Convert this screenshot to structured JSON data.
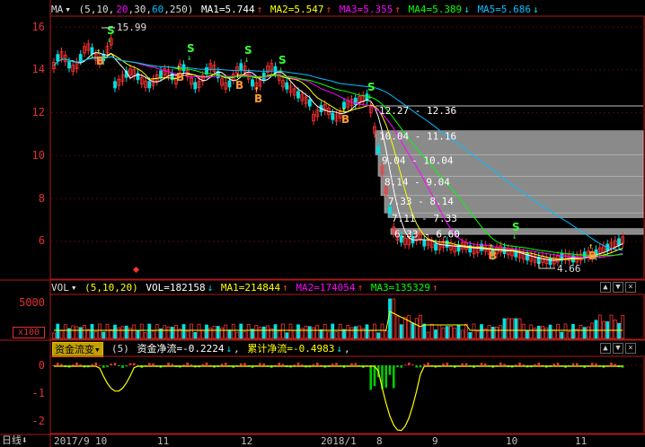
{
  "main_header": {
    "indicator": "MA",
    "params_open": "(5,10,",
    "p20": "20",
    "p30": ",30,",
    "p60": "60",
    "p250": ",250)",
    "ma1": "MA1=5.744",
    "ma2": "MA2=5.547",
    "ma3": "MA3=5.355",
    "ma4": "MA4=5.389",
    "ma5": "MA5=5.686",
    "arrow_up": "↑",
    "arrow_down": "↓"
  },
  "main_axis": {
    "ticks": [
      "16",
      "14",
      "12",
      "10",
      "8",
      "6"
    ]
  },
  "peak_label": "15.99",
  "low_label": "4.66",
  "gaps": [
    "12.27 - 12.36",
    "10.04 - 11.16",
    "9.04 - 10.04",
    "8.14 - 9.04",
    "7.33 - 8.14",
    "7.11 - 7.33",
    "6.33 - 6.60"
  ],
  "signals": {
    "buy": "B",
    "sell": "S"
  },
  "vol_header": {
    "name": "VOL",
    "params": "(5,10,20)",
    "vol": "VOL=182158",
    "ma1": "MA1=214844",
    "ma2": "MA2=174054",
    "ma3": "MA3=135329",
    "arrow_up": "↑",
    "arrow_down": "↓"
  },
  "vol_axis": {
    "top": "5000",
    "unit": "x100"
  },
  "fund_header": {
    "selector": "资金流变",
    "params": "(5)",
    "net": "资金净流=-0.2224",
    "cum": "累计净流=-0.4983",
    "arrow_down": "↓",
    "tail": ","
  },
  "fund_axis": {
    "ticks": [
      "0",
      "-1",
      "-2"
    ]
  },
  "x_axis": {
    "labels": [
      "2017/9",
      "10",
      "11",
      "12",
      "2018/1",
      "8",
      "9",
      "10",
      "11"
    ]
  },
  "period": "日线",
  "panel_buttons": {
    "up": "▲",
    "down": "▼",
    "close": "×",
    "menu": "▾"
  },
  "colors": {
    "up": "#ff3232",
    "down": "#00e0e0",
    "ma5": "#ffffff",
    "ma10": "#ffff00",
    "ma20": "#ff00ff",
    "ma30": "#00ff00",
    "ma60": "#00c0ff",
    "gap": "#a0a0a0"
  }
}
